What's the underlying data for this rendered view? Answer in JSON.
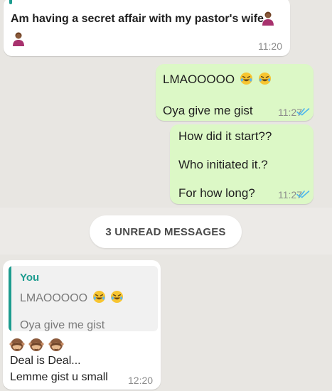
{
  "messages": {
    "m1": {
      "text": "Am having a secret affair with my pastor's wife",
      "time": "11:20"
    },
    "m2": {
      "line1": "LMAOOOOO",
      "line2": "Oya give me gist",
      "time": "11:27"
    },
    "m3": {
      "line1": "How did it start??",
      "line2": "Who initiated it.?",
      "line3": "For how long?",
      "time": "11:27"
    },
    "m4": {
      "quote_author": "You",
      "quote_line1": "LMAOOOOO",
      "quote_line2": "Oya give me gist",
      "line1": "Deal is Deal...",
      "line2": "Lemme gist u small",
      "time": "12:20"
    }
  },
  "unread_label": "3 UNREAD MESSAGES",
  "colors": {
    "incoming_bubble": "#ffffff",
    "outgoing_bubble": "#dcf8c6",
    "background": "#e8e6e2",
    "read_ticks": "#4fb6ec",
    "quote_accent": "#1d9c8f"
  },
  "icons": {
    "laugh": "rolling-on-floor-laughing-icon",
    "person": "person-shrugging-icon",
    "monkey": "see-no-evil-monkey-icon",
    "ticks": "double-check-read-icon"
  }
}
